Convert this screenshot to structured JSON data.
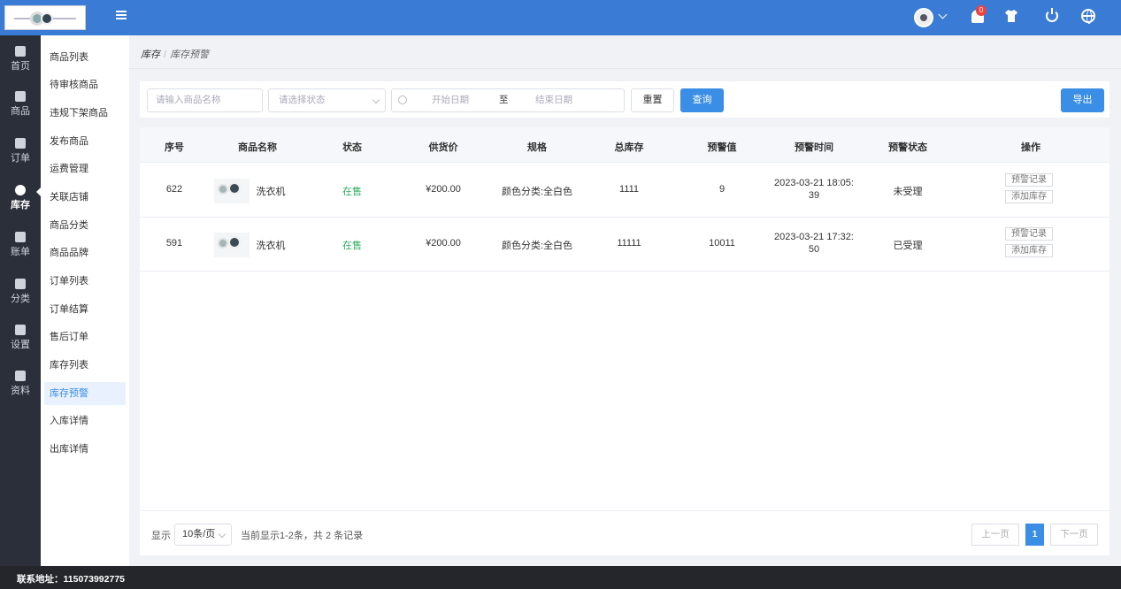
{
  "colors": {
    "brand": "#3a7bd5",
    "primary": "#3a8ee6",
    "rail": "#2b2f3a",
    "on_sale": "#2dae5f",
    "notify": "#f04040"
  },
  "topbar": {
    "icons": [
      "menu-icon",
      "user-avatar",
      "chevron-down-icon",
      "bell-icon",
      "shirt-icon",
      "power-icon",
      "globe-icon"
    ],
    "notification_count": "0"
  },
  "rail": {
    "items": [
      {
        "label": "首页",
        "icon": "home-icon"
      },
      {
        "label": "商品",
        "icon": "goods-icon"
      },
      {
        "label": "订单",
        "icon": "order-icon"
      },
      {
        "label": "库存",
        "icon": "inventory-icon",
        "active": true
      },
      {
        "label": "账单",
        "icon": "bill-icon"
      },
      {
        "label": "分类",
        "icon": "category-icon"
      },
      {
        "label": "设置",
        "icon": "settings-icon"
      },
      {
        "label": "资料",
        "icon": "profile-icon"
      }
    ]
  },
  "submenu": {
    "items": [
      "商品列表",
      "待审核商品",
      "违规下架商品",
      "发布商品",
      "运费管理",
      "关联店铺",
      "商品分类",
      "商品品牌",
      "订单列表",
      "订单结算",
      "售后订单",
      "库存列表",
      "库存预警",
      "入库详情",
      "出库详情"
    ],
    "active": "库存预警"
  },
  "breadcrumb": {
    "parent": "库存",
    "separator": "/",
    "current": "库存预警"
  },
  "filters": {
    "name_placeholder": "请输入商品名称",
    "status_placeholder": "请选择状态",
    "start_date_placeholder": "开始日期",
    "date_separator": "至",
    "end_date_placeholder": "结束日期",
    "reset_label": "重置",
    "query_label": "查询",
    "export_label": "导出"
  },
  "table": {
    "headers": [
      "序号",
      "商品名称",
      "状态",
      "供货价",
      "规格",
      "总库存",
      "预警值",
      "预警时间",
      "预警状态",
      "操作"
    ],
    "rows": [
      {
        "id": "622",
        "name": "洗衣机",
        "status": "在售",
        "price": "¥200.00",
        "spec": "颜色分类:全白色",
        "stock": "1111",
        "threshold": "9",
        "time_line1": "2023-03-21 18:05:",
        "time_line2": "39",
        "alert_status": "未受理",
        "action1": "预警记录",
        "action2": "添加库存"
      },
      {
        "id": "591",
        "name": "洗衣机",
        "status": "在售",
        "price": "¥200.00",
        "spec": "颜色分类:全白色",
        "stock": "11111",
        "threshold": "10011",
        "time_line1": "2023-03-21 17:32:",
        "time_line2": "50",
        "alert_status": "已受理",
        "action1": "预警记录",
        "action2": "添加库存"
      }
    ]
  },
  "pagination": {
    "show_label": "显示",
    "page_size": "10条/页",
    "summary": "当前显示1-2条，共 2 条记录",
    "prev_label": "上一页",
    "current_page": "1",
    "next_label": "下一页"
  },
  "footer": {
    "contact": "联系地址：115073992775"
  }
}
